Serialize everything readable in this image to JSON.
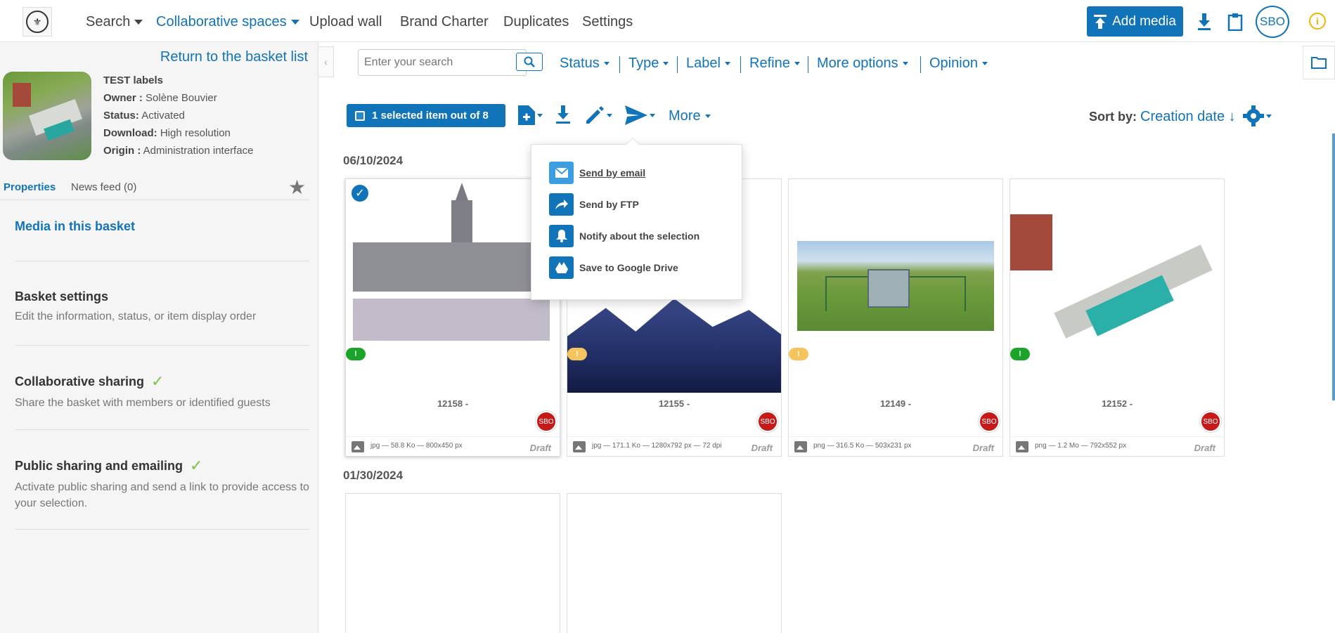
{
  "nav": {
    "search": "Search",
    "collab": "Collaborative spaces",
    "upload": "Upload wall",
    "brand": "Brand Charter",
    "duplicates": "Duplicates",
    "settings": "Settings",
    "add_media": "Add media",
    "user_initials": "SBO",
    "info": "i"
  },
  "sidebar": {
    "return_link": "Return to the basket list",
    "basket": {
      "title": "TEST labels",
      "owner_label": "Owner :",
      "owner": "Solène Bouvier",
      "status_label": "Status:",
      "status": "Activated",
      "download_label": "Download:",
      "download": "High resolution",
      "origin_label": "Origin :",
      "origin": "Administration interface"
    },
    "tabs": {
      "properties": "Properties",
      "news": "News feed (0)"
    },
    "sections": {
      "media": "Media in this basket",
      "settings_title": "Basket settings",
      "settings_desc": "Edit the information, status, or item display order",
      "collab_title": "Collaborative sharing",
      "collab_desc": "Share the basket with members or identified guests",
      "public_title": "Public sharing and emailing",
      "public_desc": "Activate public sharing and send a link to provide access to your selection."
    }
  },
  "filters": {
    "search_placeholder": "Enter your search",
    "status": "Status",
    "type": "Type",
    "label": "Label",
    "refine": "Refine",
    "more_options": "More options",
    "opinion": "Opinion"
  },
  "actions": {
    "selected": "1 selected item out of 8",
    "more": "More",
    "sort_label": "Sort by:",
    "sort_value": "Creation date ↓"
  },
  "dropdown": {
    "email": "Send by email",
    "ftp": "Send by FTP",
    "notify": "Notify about the selection",
    "gdrive": "Save to Google Drive"
  },
  "groups": [
    {
      "date": "06/10/2024"
    },
    {
      "date": "01/30/2024"
    }
  ],
  "cards": [
    {
      "id": "12158 -",
      "owner": "SBO",
      "meta": "jpg — 58.8 Ko — 800x450 px",
      "state": "Draft",
      "status_mark": "!"
    },
    {
      "id": "12155 -",
      "owner": "SBO",
      "meta": "jpg — 171.1 Ko — 1280x792 px — 72 dpi",
      "state": "Draft",
      "status_mark": "!"
    },
    {
      "id": "12149 -",
      "owner": "SBO",
      "meta": "png — 316.5 Ko — 503x231 px",
      "state": "Draft",
      "status_mark": "!"
    },
    {
      "id": "12152 -",
      "owner": "SBO",
      "meta": "png — 1.2 Mo — 792x552 px",
      "state": "Draft",
      "status_mark": "!"
    }
  ],
  "colors": {
    "accent": "#1173b8",
    "owner_badge": "#c61a1a",
    "status_green": "#1aa52a",
    "status_yellow": "#f5c45c",
    "check_green": "#7cc24a"
  }
}
